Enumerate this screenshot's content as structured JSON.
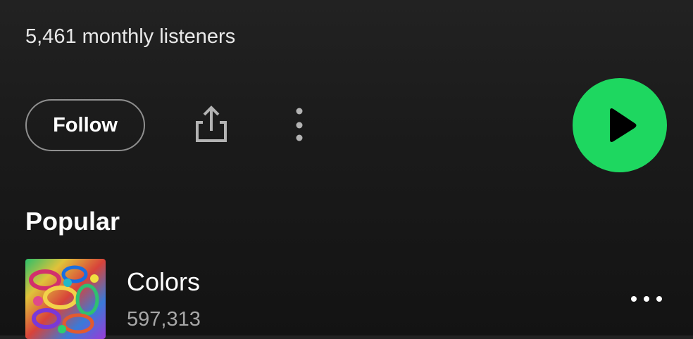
{
  "artist": {
    "monthly_listeners": "5,461 monthly listeners"
  },
  "actions": {
    "follow_label": "Follow",
    "share_icon": "share-icon",
    "more_icon": "more-vertical-icon",
    "play_icon": "play-icon"
  },
  "popular": {
    "section_title": "Popular",
    "tracks": [
      {
        "title": "Colors",
        "plays": "597,313",
        "more_icon": "more-horizontal-icon"
      }
    ]
  },
  "colors": {
    "background": "#121212",
    "accent_green": "#1ed760",
    "secondary_text": "#a7a7a7",
    "button_border": "#8f8f8f"
  }
}
